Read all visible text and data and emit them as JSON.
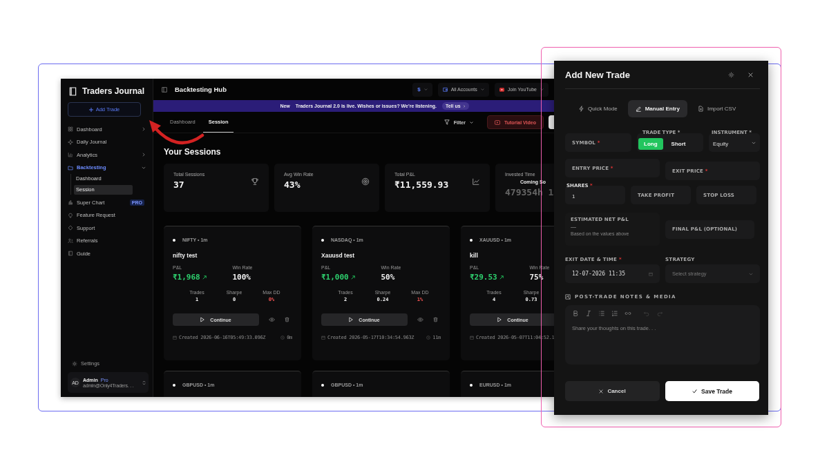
{
  "app": {
    "sidebar": {
      "title": "Traders Journal",
      "add_button": "Add Trade",
      "items": [
        {
          "label": "Dashboard",
          "selected": false,
          "expanded": false
        },
        {
          "label": "Daily Journal",
          "selected": false
        },
        {
          "label": "Analytics",
          "selected": false,
          "expanded": false
        },
        {
          "label": "Backtesting",
          "selected": true,
          "expanded": true,
          "children": [
            {
              "label": "Dashboard",
              "selected": false
            },
            {
              "label": "Session",
              "selected": true
            }
          ]
        },
        {
          "label": "Super Chart",
          "selected": false,
          "badge": "PRO"
        },
        {
          "label": "Feature Request",
          "selected": false
        },
        {
          "label": "Support",
          "selected": false
        },
        {
          "label": "Referrals",
          "selected": false
        },
        {
          "label": "Guide",
          "selected": false
        }
      ],
      "settings": "Settings",
      "user": {
        "initials": "AD",
        "name": "Admin",
        "plan": "Pro",
        "email": "admin@Only4Traders. . ."
      }
    },
    "topbar": {
      "title": "Backtesting Hub",
      "currency": "$",
      "account": "All Accounts",
      "youtube": "Join YouTube"
    },
    "banner": {
      "tag": "New",
      "text": "Traders Journal 2.0 is live. Wishes or issues? We're listening.",
      "button": "Tell us"
    },
    "tabs": [
      {
        "label": "Dashboard",
        "selected": false
      },
      {
        "label": "Session",
        "selected": true
      }
    ],
    "filter": "Filter",
    "tutorial": "Tutorial Video",
    "heading": "Your Sessions",
    "stats": [
      {
        "label": "Total Sessions",
        "value": "37"
      },
      {
        "label": "Avg Win Rate",
        "value": "43%"
      },
      {
        "label": "Total P&L",
        "value": "₹11,559.93"
      },
      {
        "label": "Invested Time",
        "note": "Coming So",
        "value": "479354h 1"
      }
    ],
    "sessions": [
      {
        "symbol": "NIFTY • 1m",
        "name": "nifty test",
        "pnl_label": "P&L",
        "pnl": "₹1,968",
        "win_label": "Win Rate",
        "win_rate": "100%",
        "trades_label": "Trades",
        "trades": "1",
        "sharpe_label": "Sharpe",
        "sharpe": "0",
        "max_dd_label": "Max DD",
        "max_dd": "0%",
        "continue": "Continue",
        "created": "Created 2026-06-16T05:49:33.096Z",
        "duration": "0m"
      },
      {
        "symbol": "NASDAQ • 1m",
        "name": "Xauusd test",
        "pnl_label": "P&L",
        "pnl": "₹1,000",
        "win_label": "Win Rate",
        "win_rate": "50%",
        "trades_label": "Trades",
        "trades": "2",
        "sharpe_label": "Sharpe",
        "sharpe": "0.24",
        "max_dd_label": "Max DD",
        "max_dd": "1%",
        "continue": "Continue",
        "created": "Created 2026-05-17T10:34:54.963Z",
        "duration": "11m"
      },
      {
        "symbol": "XAUUSD • 1m",
        "name": "kill",
        "pnl_label": "P&L",
        "pnl": "₹29.53",
        "win_label": "Win Rate",
        "win_rate": "75%",
        "trades_label": "Trades",
        "trades": "4",
        "sharpe_label": "Sharpe",
        "sharpe": "0.73",
        "continue": "Continue",
        "created": "Created 2026-05-07T11:04:52.1"
      },
      {
        "symbol": "GBPUSD • 1m"
      },
      {
        "symbol": "GBPUSD • 1m"
      },
      {
        "symbol": "EURUSD • 1m"
      }
    ]
  },
  "modal": {
    "title": "Add New Trade",
    "tabs": [
      {
        "label": "Quick Mode",
        "selected": false
      },
      {
        "label": "Manual Entry",
        "selected": true
      },
      {
        "label": "Import CSV",
        "selected": false
      }
    ],
    "symbol": {
      "label": "SYMBOL",
      "mark": "*"
    },
    "trade_type": {
      "label": "TRADE TYPE",
      "mark": "*",
      "options": [
        {
          "label": "Long",
          "selected": true
        },
        {
          "label": "Short",
          "selected": false
        }
      ]
    },
    "instrument": {
      "label": "INSTRUMENT",
      "mark": "*",
      "value": "Equity"
    },
    "entry_price": {
      "label": "ENTRY PRICE",
      "mark": "*"
    },
    "exit_price": {
      "label": "EXIT PRICE",
      "mark": "*"
    },
    "shares": {
      "label": "SHARES",
      "mark": "*",
      "value": "1"
    },
    "take_profit": {
      "label": "TAKE PROFIT"
    },
    "stop_loss": {
      "label": "STOP LOSS"
    },
    "estimate": {
      "label": "ESTIMATED NET P&L",
      "value": "—",
      "note": "Based on the values above"
    },
    "final_pnl": {
      "label": "FINAL P&L (OPTIONAL)"
    },
    "exit_date": {
      "label": "EXIT DATE & TIME",
      "mark": "*",
      "value": "12-07-2026 11:35"
    },
    "strategy": {
      "label": "STRATEGY",
      "placeholder": "Select strategy"
    },
    "notes": {
      "label": "POST-TRADE NOTES & MEDIA",
      "placeholder": "Share your thoughts on this trade. . ."
    },
    "cancel": "Cancel",
    "save": "Save Trade"
  }
}
